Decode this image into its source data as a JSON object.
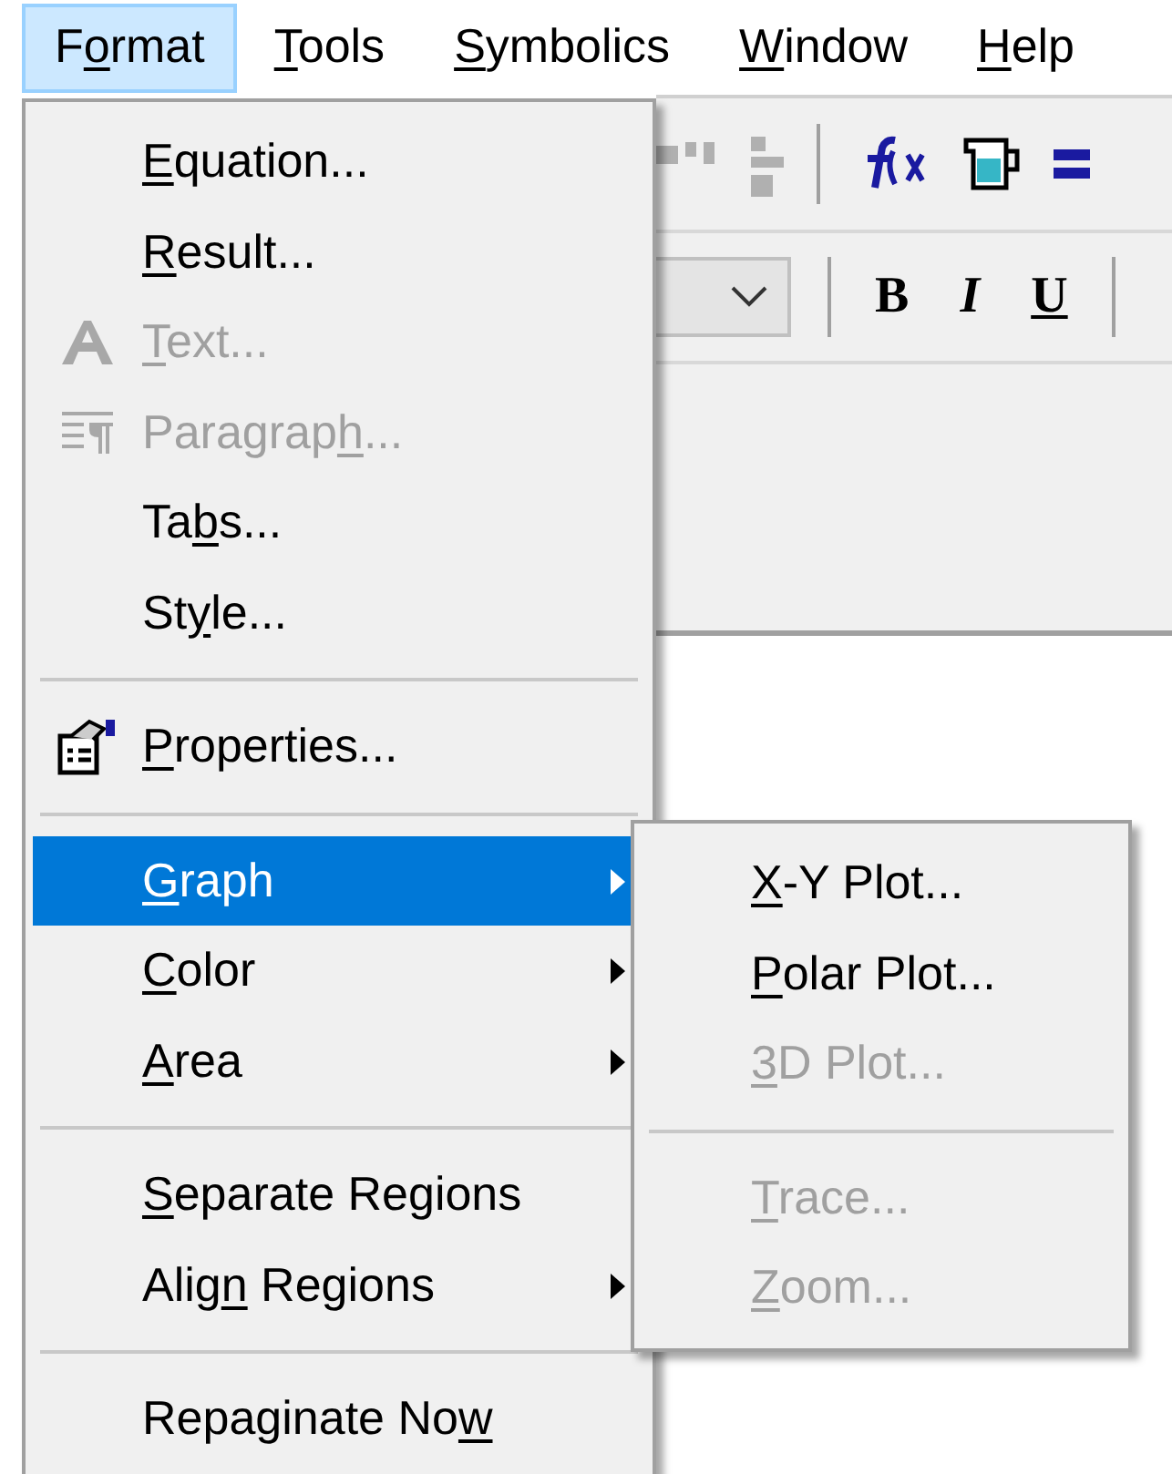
{
  "menu_bar": [
    {
      "label": {
        "pre": "F",
        "key": "o",
        "post": "rmat"
      },
      "selected": true
    },
    {
      "label": {
        "key": "T",
        "post": "ools"
      },
      "selected": false
    },
    {
      "label": {
        "key": "S",
        "post": "ymbolics"
      },
      "selected": false
    },
    {
      "label": {
        "key": "W",
        "post": "indow"
      },
      "selected": false
    },
    {
      "label": {
        "key": "H",
        "post": "elp"
      },
      "selected": false
    }
  ],
  "toolbar": {
    "format_buttons": [
      "B",
      "I",
      "U"
    ]
  },
  "format_menu": {
    "items": [
      {
        "kind": "item",
        "label": {
          "key": "E",
          "post": "quation..."
        },
        "disabled": false,
        "submenu": false,
        "selected": false
      },
      {
        "kind": "item",
        "label": {
          "key": "R",
          "post": "esult..."
        },
        "disabled": false,
        "submenu": false,
        "selected": false
      },
      {
        "kind": "item",
        "label": {
          "key": "T",
          "post": "ext..."
        },
        "disabled": true,
        "submenu": false,
        "selected": false
      },
      {
        "kind": "item",
        "label": {
          "pre": "Paragrap",
          "key": "h",
          "post": "..."
        },
        "disabled": true,
        "submenu": false,
        "selected": false
      },
      {
        "kind": "item",
        "label": {
          "pre": "Ta",
          "key": "b",
          "post": "s..."
        },
        "disabled": false,
        "submenu": false,
        "selected": false
      },
      {
        "kind": "item",
        "label": {
          "pre": "St",
          "key": "y",
          "post": "le..."
        },
        "disabled": false,
        "submenu": false,
        "selected": false
      },
      {
        "kind": "separator"
      },
      {
        "kind": "item",
        "label": {
          "key": "P",
          "post": "roperties..."
        },
        "disabled": false,
        "submenu": false,
        "selected": false
      },
      {
        "kind": "separator"
      },
      {
        "kind": "item",
        "label": {
          "key": "G",
          "post": "raph"
        },
        "disabled": false,
        "submenu": true,
        "selected": true
      },
      {
        "kind": "item",
        "label": {
          "key": "C",
          "post": "olor"
        },
        "disabled": false,
        "submenu": true,
        "selected": false
      },
      {
        "kind": "item",
        "label": {
          "key": "A",
          "post": "rea"
        },
        "disabled": false,
        "submenu": true,
        "selected": false
      },
      {
        "kind": "separator"
      },
      {
        "kind": "item",
        "label": {
          "key": "S",
          "post": "eparate Regions"
        },
        "disabled": false,
        "submenu": false,
        "selected": false
      },
      {
        "kind": "item",
        "label": {
          "pre": "Alig",
          "key": "n",
          "post": " Regions"
        },
        "disabled": false,
        "submenu": true,
        "selected": false
      },
      {
        "kind": "separator"
      },
      {
        "kind": "item",
        "label": {
          "pre": "Repaginate No",
          "key": "w"
        },
        "disabled": false,
        "submenu": false,
        "selected": false
      }
    ]
  },
  "graph_submenu": {
    "items": [
      {
        "kind": "item",
        "label": {
          "key": "X",
          "post": "-Y Plot..."
        },
        "disabled": false
      },
      {
        "kind": "item",
        "label": {
          "key": "P",
          "post": "olar Plot..."
        },
        "disabled": false
      },
      {
        "kind": "item",
        "label": {
          "key": "3",
          "post": "D Plot..."
        },
        "disabled": true
      },
      {
        "kind": "separator"
      },
      {
        "kind": "item",
        "label": {
          "key": "T",
          "post": "race..."
        },
        "disabled": true
      },
      {
        "kind": "item",
        "label": {
          "key": "Z",
          "post": "oom..."
        },
        "disabled": true
      }
    ]
  }
}
